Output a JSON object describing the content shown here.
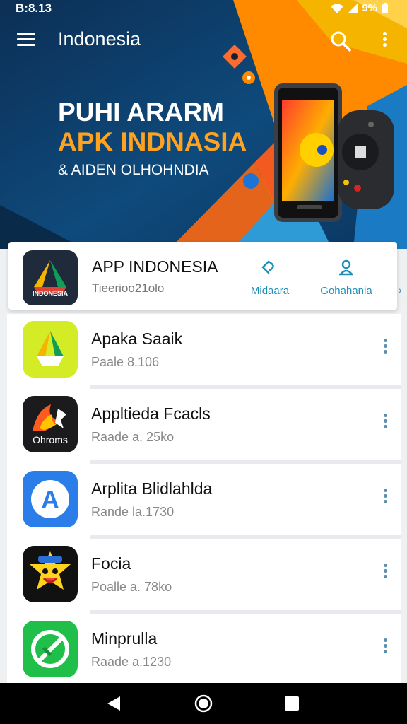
{
  "status_bar": {
    "time": "B:8.13",
    "battery": "9%"
  },
  "app_bar": {
    "title": "Indonesia"
  },
  "banner": {
    "line1": "PUHI ARARM",
    "line2": "APK INDNASIA",
    "line3": "& AIDEN OLHOHNDIA"
  },
  "featured": {
    "title": "APP INDONESIA",
    "subtitle": "Tieerioo21olo",
    "icon_label": "INDONESIA",
    "action1_label": "Midaara",
    "action2_label": "Gohahania"
  },
  "apps": [
    {
      "title": "Apaka Saaik",
      "subtitle": "Paale 8.106",
      "icon": "drive-icon"
    },
    {
      "title": "Appltieda Fcacls",
      "subtitle": "Raade a. 25ko",
      "icon": "chrome-flame-icon",
      "icon_label": "Ohroms"
    },
    {
      "title": "Arplita Blidlahlda",
      "subtitle": "Rande la.1730",
      "icon": "letter-a-icon",
      "icon_letter": "A"
    },
    {
      "title": "Focia",
      "subtitle": "Poalle a. 78ko",
      "icon": "mascot-icon"
    },
    {
      "title": "Minprulla",
      "subtitle": "Raade a.1230",
      "icon": "phone-slash-icon"
    }
  ],
  "colors": {
    "hero_dark": "#0d3b66",
    "hero_orange": "#ff8a00",
    "accent_teal": "#1f8fb5",
    "nav_bar": "#000000"
  }
}
